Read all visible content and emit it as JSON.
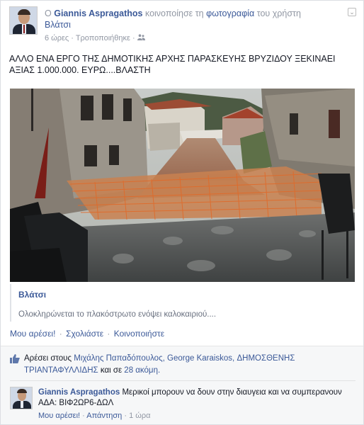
{
  "header": {
    "prefix": "Ο",
    "author": "Giannis Aspragathos",
    "action": "κοινοποίησε τη",
    "object_link": "φωτογραφία",
    "of_user": "του χρήστη",
    "target_user": "Βλάτσι",
    "time": "6 ώρες",
    "edited": "Τροποποιήθηκε",
    "audience_icon": "friends-icon"
  },
  "post": {
    "text": "ΑΛΛΟ ΕΝΑ ΕΡΓΟ ΤΗΣ ΔΗΜΟΤΙΚΗΣ ΑΡΧΗΣ ΠΑΡΑΣΚΕΥΗΣ ΒΡΥΖΙΔΟΥ ΞΕΚΙΝΑΕΙ ΑΞΙΑΣ 1.000.000. ΕΥΡΩ....ΒΛΑΣΤΗ"
  },
  "attachment": {
    "title": "Βλάτσι",
    "description": "Ολοκληρώνεται το πλακόστρωτο ενόψει καλοκαιριού...."
  },
  "actions": {
    "like": "Μου αρέσει!",
    "comment": "Σχολιάστε",
    "share": "Κοινοποιήστε",
    "separator": "·"
  },
  "likes": {
    "prefix": "Αρέσει στους",
    "user1": "Μιχάλης Παπαδόπουλος,",
    "user2": "George Karaiskos,",
    "user3": "ΔΗΜΟΣΘΕΝΗΣ ΤΡΙΑΝΤΑΦΥΛΛΙΔΗΣ",
    "and": "και σε",
    "more": "28 ακόμη."
  },
  "comment": {
    "author": "Giannis Aspragathos",
    "text": "Μερικοί μπορουν να δουν στην διαυγεια και να συμπερανουν ΑΔΑ: ΒΙΦ2ΩΡ6-ΔΩΛ",
    "like": "Μου αρέσει!",
    "reply": "Απάντηση",
    "time": "1 ώρα"
  },
  "colors": {
    "link": "#3b5998",
    "meta": "#9197a3",
    "feedback_bg": "#f6f7f8"
  }
}
